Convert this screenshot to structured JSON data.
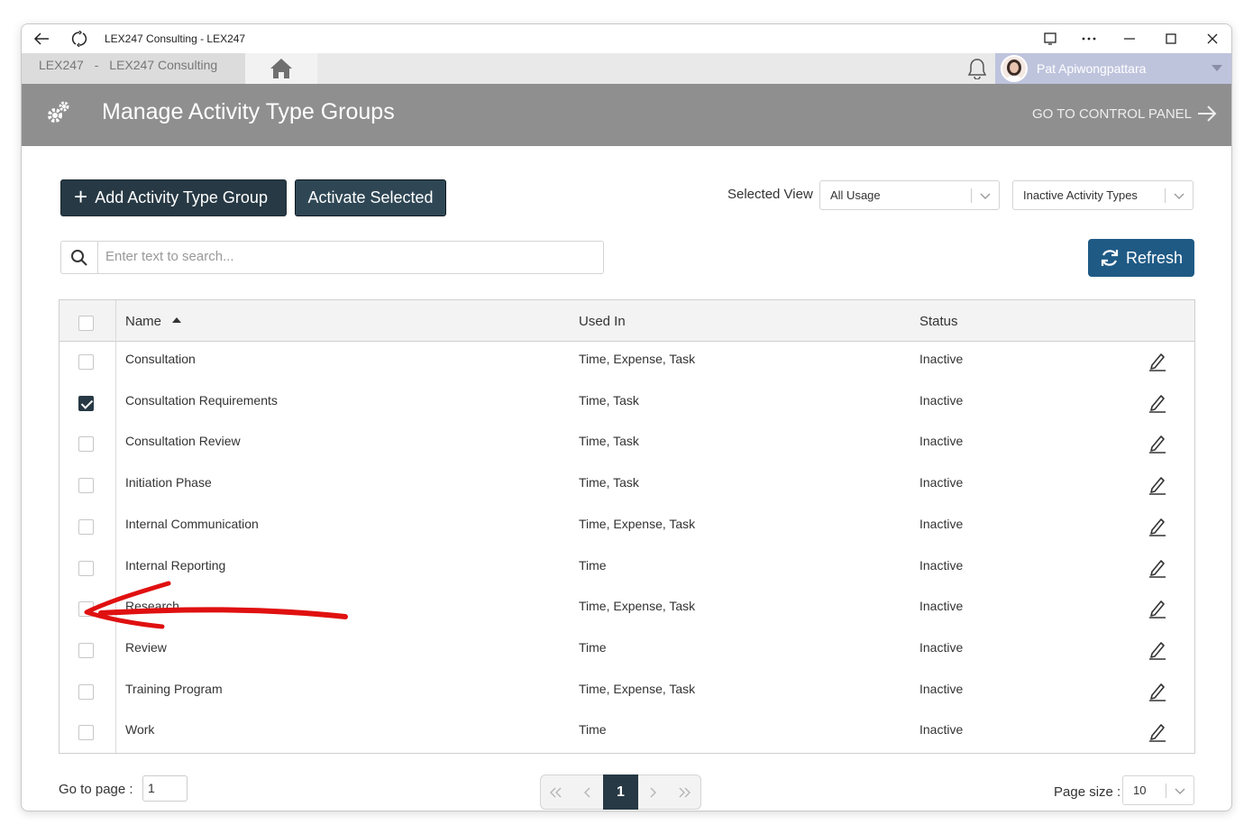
{
  "window": {
    "title": "LEX247 Consulting - LEX247"
  },
  "appbar": {
    "org": "LEX247",
    "separator": "-",
    "company": "LEX247 Consulting",
    "user_name": "Pat Apiwongpattara"
  },
  "header": {
    "title": "Manage Activity Type Groups",
    "goto_label": "GO TO CONTROL PANEL"
  },
  "toolbar": {
    "add_label": "Add Activity Type Group",
    "activate_label": "Activate Selected",
    "selected_view_label": "Selected View",
    "view_value": "All Usage",
    "type_filter_value": "Inactive Activity Types",
    "refresh_label": "Refresh"
  },
  "search": {
    "placeholder": "Enter text to search..."
  },
  "table": {
    "columns": [
      "Name",
      "Used In",
      "Status"
    ],
    "sort": {
      "column": "Name",
      "direction": "ascending"
    },
    "rows": [
      {
        "name": "Consultation",
        "used_in": "Time, Expense, Task",
        "status": "Inactive",
        "checked": false
      },
      {
        "name": "Consultation Requirements",
        "used_in": "Time, Task",
        "status": "Inactive",
        "checked": true
      },
      {
        "name": "Consultation Review",
        "used_in": "Time, Task",
        "status": "Inactive",
        "checked": false
      },
      {
        "name": "Initiation Phase",
        "used_in": "Time, Task",
        "status": "Inactive",
        "checked": false
      },
      {
        "name": "Internal Communication",
        "used_in": "Time, Expense, Task",
        "status": "Inactive",
        "checked": false
      },
      {
        "name": "Internal Reporting",
        "used_in": "Time",
        "status": "Inactive",
        "checked": false
      },
      {
        "name": "Research",
        "used_in": "Time, Expense, Task",
        "status": "Inactive",
        "checked": false
      },
      {
        "name": "Review",
        "used_in": "Time",
        "status": "Inactive",
        "checked": false
      },
      {
        "name": "Training Program",
        "used_in": "Time, Expense, Task",
        "status": "Inactive",
        "checked": false
      },
      {
        "name": "Work",
        "used_in": "Time",
        "status": "Inactive",
        "checked": false
      }
    ]
  },
  "footer": {
    "goto_page_label": "Go to page :",
    "goto_page_value": "1",
    "current_page": "1",
    "page_size_label": "Page size :",
    "page_size_value": "10"
  },
  "colors": {
    "header_bg": "#8f8f8f",
    "primary_dark": "#273944",
    "refresh_blue": "#1f5a85",
    "annotation_red": "#e01010"
  },
  "icons": [
    "back-arrow-icon",
    "reload-icon",
    "home-icon",
    "bell-icon",
    "gear-icon",
    "arrow-right-icon",
    "plus-icon",
    "search-icon",
    "refresh-icon",
    "pencil-edit-icon",
    "chevron-down-icon",
    "double-chevron-left-icon",
    "chevron-left-icon",
    "chevron-right-icon",
    "double-chevron-right-icon"
  ]
}
